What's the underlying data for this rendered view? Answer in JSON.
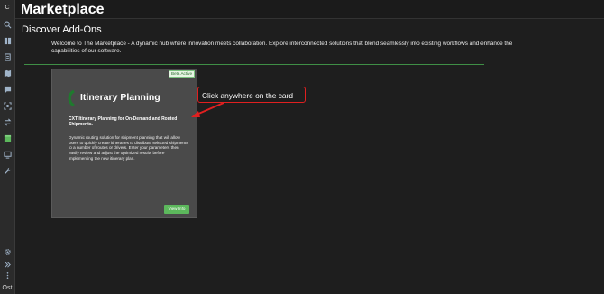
{
  "sidebar": {
    "top_label": "C",
    "bottom_label": "Ost",
    "items": [
      {
        "icon": "search-icon"
      },
      {
        "icon": "dashboard-icon"
      },
      {
        "icon": "document-icon"
      },
      {
        "icon": "map-icon"
      },
      {
        "icon": "message-icon"
      },
      {
        "icon": "scan-icon"
      },
      {
        "icon": "transfer-icon"
      },
      {
        "icon": "marketplace-icon"
      },
      {
        "icon": "screen-icon"
      },
      {
        "icon": "wrench-icon"
      }
    ],
    "bottom_items": [
      {
        "icon": "gear-icon"
      },
      {
        "icon": "expand-icon"
      },
      {
        "icon": "more-vertical-icon"
      }
    ]
  },
  "header": {
    "title": "Marketplace"
  },
  "main": {
    "section_title": "Discover Add-Ons",
    "intro": "Welcome to The Marketplace - A dynamic hub where innovation meets collaboration. Explore interconnected solutions that blend seamlessly into existing workflows and enhance the capabilities of our software."
  },
  "card": {
    "badge": "Beta Active",
    "title": "Itinerary Planning",
    "subtitle": "CXT Itinerary Planning for On-Demand and Routed Shipments.",
    "description": "Dynamic routing solution for shipment planning that will allow users to quickly create itineraries to distribute selected shipments to a number of routes or drivers. Enter your parameters then easily review and adjust the optimized results before implementing the new itinerary plan.",
    "button_label": "View Info"
  },
  "annotation": {
    "text": "Click anywhere on the card"
  },
  "colors": {
    "background": "#1e1e1e",
    "accent_green": "#5cb85c",
    "callout_red": "#e02020"
  }
}
